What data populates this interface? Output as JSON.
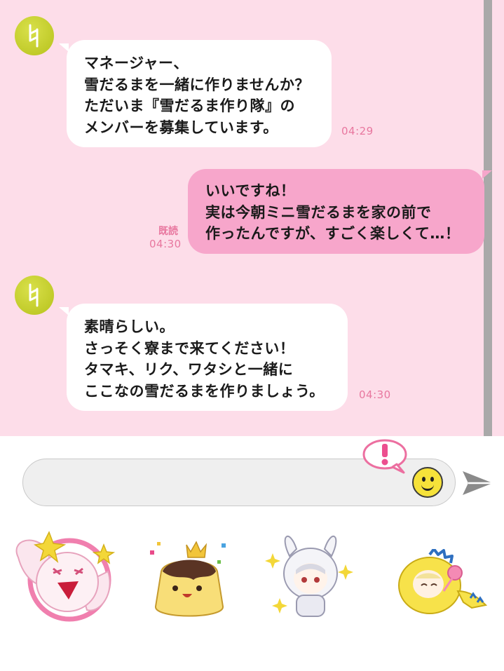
{
  "messages": [
    {
      "direction": "in",
      "text": "マネージャー、\n雪だるまを一緒に作りませんか？\nただいま『雪だるま作り隊』の\nメンバーを募集しています。",
      "time": "04:29"
    },
    {
      "direction": "out",
      "text": "いいですね！\n実は今朝ミニ雪だるまを家の前で\n作ったんですが、すごく楽しくて…！",
      "time": "04:30",
      "status": "既読"
    },
    {
      "direction": "in",
      "text": "素晴らしい。\nさっそく寮まで来てください！\nタマキ、リク、ワタシと一緒に\nここなの雪だるまを作りましょう。",
      "time": "04:30"
    }
  ],
  "input": {
    "value": "",
    "placeholder": ""
  },
  "icons": {
    "avatar": "tuning-note-avatar-icon",
    "alert": "exclamation-bubble-icon",
    "emoji": "smiley-face-icon",
    "send": "send-arrow-icon"
  },
  "stickers": [
    {
      "name": "sticker-pink-ghost"
    },
    {
      "name": "sticker-pudding-crown"
    },
    {
      "name": "sticker-bunny-hood-character"
    },
    {
      "name": "sticker-dinosaur-costume-character"
    }
  ],
  "colors": {
    "chat_background": "#fddde9",
    "outgoing_bubble": "#f7a6cb",
    "incoming_bubble": "#ffffff",
    "timestamp": "#e8779f",
    "avatar": "#c2cc26"
  }
}
